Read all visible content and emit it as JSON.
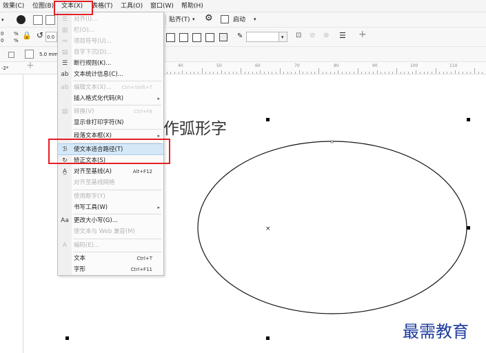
{
  "menubar": {
    "items": [
      "效果(C)",
      "位图(B)",
      "文本(X)",
      "表格(T)",
      "工具(O)",
      "窗口(W)",
      "帮助(H)"
    ]
  },
  "toolbar1": {
    "align_label": "贴齐(T)",
    "launch_label": "启动"
  },
  "toolbar2": {
    "percent_top": "0",
    "percent_bottom": "0",
    "pct": "%",
    "rotate_value": "0.0"
  },
  "toolbar3": {
    "nudge_value": "5.0 mm"
  },
  "document_tab": "-2*",
  "ruler": {
    "labels": [
      "40",
      "50",
      "60",
      "70",
      "80",
      "90",
      "100",
      "110"
    ]
  },
  "text_menu": {
    "items": [
      {
        "label": "对齐(I)...",
        "shortcut": "",
        "disabled": true
      },
      {
        "label": "栏(O)...",
        "shortcut": "",
        "disabled": true
      },
      {
        "label": "项目符号(U)...",
        "shortcut": "",
        "disabled": true
      },
      {
        "label": "首字下沉(D)...",
        "shortcut": "",
        "disabled": true
      },
      {
        "label": "断行规则(K)...",
        "shortcut": "",
        "disabled": false
      },
      {
        "label": "文本统计信息(C)...",
        "shortcut": "",
        "disabled": false
      },
      {
        "label": "编辑文本(X)...",
        "shortcut": "Ctrl+Shift+T",
        "disabled": true
      },
      {
        "label": "插入格式化代码(R)",
        "shortcut": "",
        "disabled": false,
        "submenu": true
      },
      {
        "label": "转换(V)",
        "shortcut": "Ctrl+F8",
        "disabled": true
      },
      {
        "label": "显示非打印字符(N)",
        "shortcut": "",
        "disabled": false
      },
      {
        "label": "段落文本框(X)",
        "shortcut": "",
        "disabled": false,
        "submenu": true
      },
      {
        "label": "使文本适合路径(T)",
        "shortcut": "",
        "disabled": false,
        "highlighted": true
      },
      {
        "label": "矫正文本(S)",
        "shortcut": "",
        "disabled": false
      },
      {
        "label": "对齐至基线(A)",
        "shortcut": "Alt+F12",
        "disabled": false
      },
      {
        "label": "对齐至基线网格",
        "shortcut": "",
        "disabled": true
      },
      {
        "label": "使用断字(Y)",
        "shortcut": "",
        "disabled": true
      },
      {
        "label": "书写工具(W)",
        "shortcut": "",
        "disabled": false,
        "submenu": true
      },
      {
        "label": "更改大小写(G)...",
        "shortcut": "",
        "disabled": false
      },
      {
        "label": "使文本与 Web 兼容(M)",
        "shortcut": "",
        "disabled": true
      },
      {
        "label": "编码(E)...",
        "shortcut": "",
        "disabled": true
      },
      {
        "label": "文本",
        "shortcut": "Ctrl+T",
        "disabled": false
      },
      {
        "label": "字形",
        "shortcut": "Ctrl+F11",
        "disabled": false
      }
    ]
  },
  "canvas": {
    "text": "作弧形字",
    "watermark": "最需教育"
  },
  "colors": {
    "highlight": "#d5e8f7",
    "red_box": "#e31e24",
    "watermark": "#1d3a9e"
  }
}
